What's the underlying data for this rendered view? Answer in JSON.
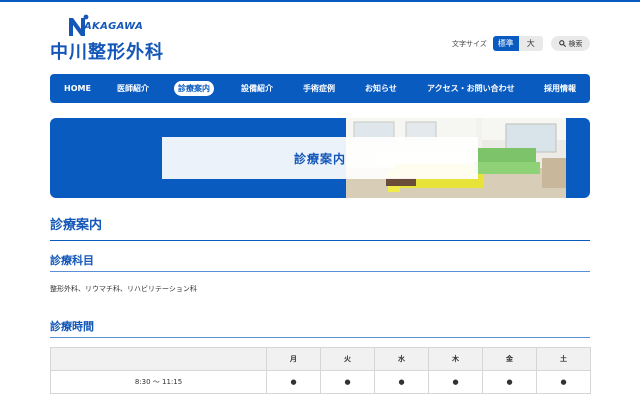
{
  "site": {
    "logo_en": "AKAGAWA",
    "logo_ja": "中川整形外科"
  },
  "header": {
    "font_size_label": "文字サイズ",
    "font_size_normal": "標準",
    "font_size_large": "大",
    "search_label": "検索"
  },
  "nav": {
    "items": [
      {
        "label": "HOME",
        "active": false
      },
      {
        "label": "医師紹介",
        "active": false
      },
      {
        "label": "診療案内",
        "active": true
      },
      {
        "label": "設備紹介",
        "active": false
      },
      {
        "label": "手術症例",
        "active": false
      },
      {
        "label": "お知らせ",
        "active": false
      },
      {
        "label": "アクセス・お問い合わせ",
        "active": false
      },
      {
        "label": "採用情報",
        "active": false
      }
    ]
  },
  "banner": {
    "title": "診療案内"
  },
  "content": {
    "heading": "診療案内",
    "departments_heading": "診療科目",
    "departments_text": "整形外科、リウマチ科、リハビリテーション科",
    "hours_heading": "診療時間",
    "hours_table": {
      "header": [
        "",
        "月",
        "火",
        "水",
        "木",
        "金",
        "土"
      ],
      "rows": [
        {
          "time": "8:30 〜 11:15",
          "cells": [
            "●",
            "●",
            "●",
            "●",
            "●",
            "●"
          ]
        }
      ]
    }
  },
  "colors": {
    "brand_blue": "#0a5bc0",
    "heading_blue": "#1457b8"
  },
  "icons": {
    "search": "search-icon",
    "logo_mark": "logo-n-icon"
  }
}
